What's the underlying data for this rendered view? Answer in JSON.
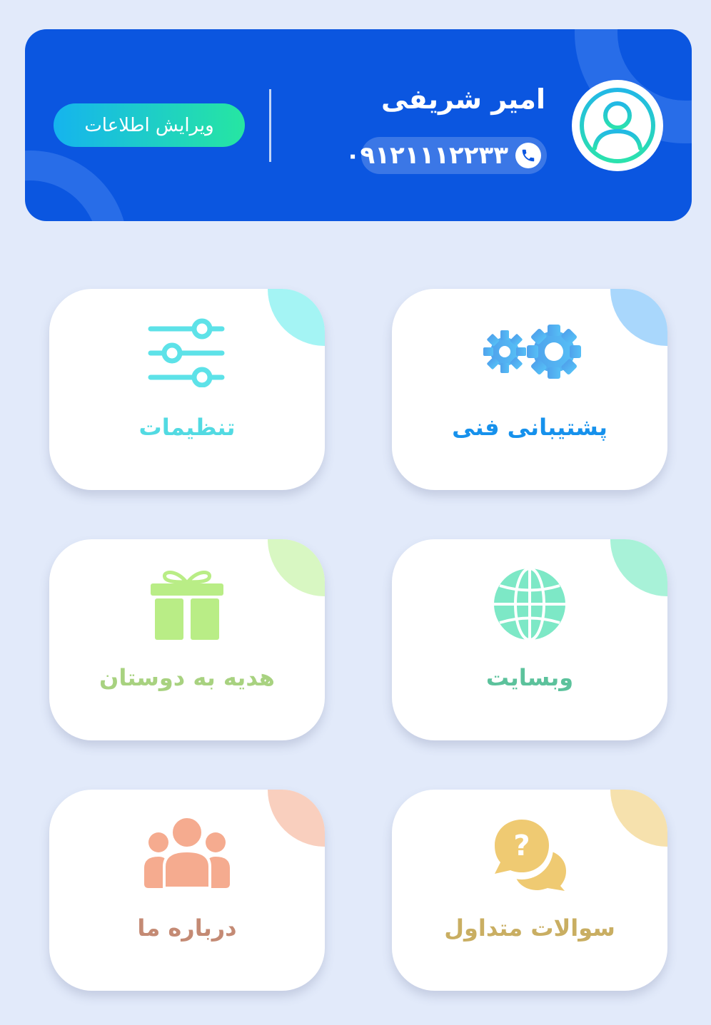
{
  "profile": {
    "name": "امیر شریفی",
    "phone": "۰۹۱۲۱۱۱۲۲۳۳",
    "edit_label": "ویرایش اطلاعات"
  },
  "tiles": [
    {
      "label": "پشتیبانی فنی",
      "icon": "gears-icon",
      "color": "#1691ec",
      "corner": "#a9d7fc"
    },
    {
      "label": "تنظیمات",
      "icon": "sliders-icon",
      "color": "#52dae2",
      "corner": "#a4f4f4"
    },
    {
      "label": "وبسایت",
      "icon": "globe-icon",
      "color": "#5cc29c",
      "corner": "#a8f2d8"
    },
    {
      "label": "هدیه به دوستان",
      "icon": "gift-icon",
      "color": "#a8d280",
      "corner": "#d8f7c2"
    },
    {
      "label": "سوالات متداول",
      "icon": "question-chat-icon",
      "color": "#c9ae62",
      "corner": "#f6e1ad"
    },
    {
      "label": "درباره ما",
      "icon": "group-icon",
      "color": "#c48a74",
      "corner": "#f9cfbe"
    }
  ]
}
